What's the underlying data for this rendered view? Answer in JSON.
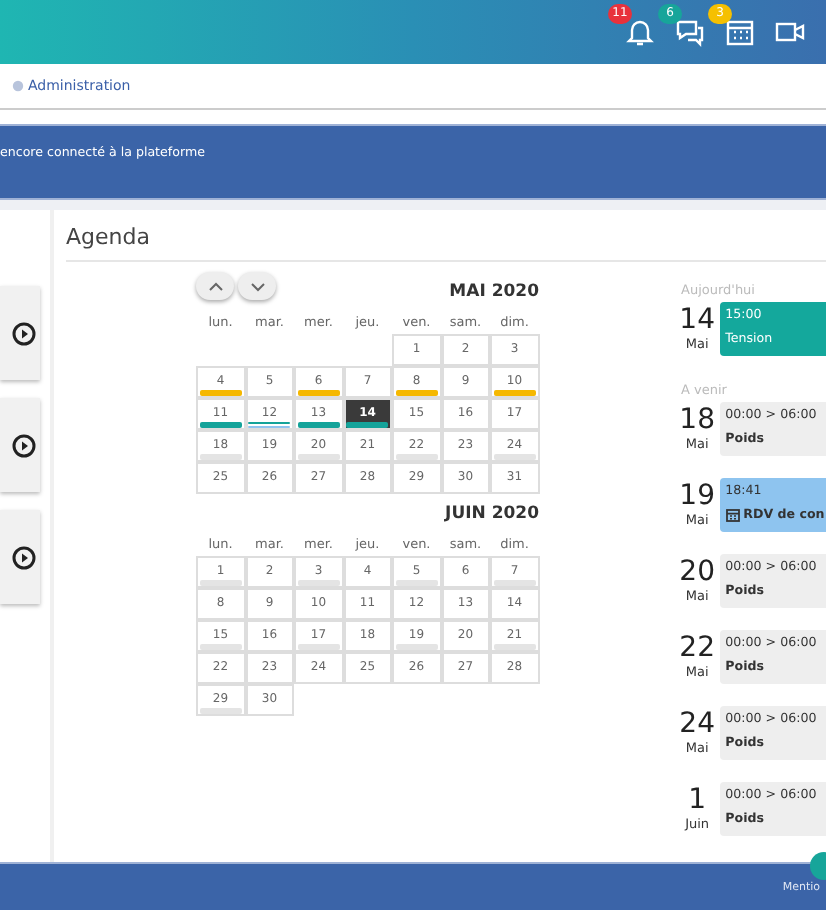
{
  "header": {
    "icons": [
      {
        "kind": "bell",
        "badge": "11",
        "color": "#e8323c"
      },
      {
        "kind": "chat",
        "badge": "6",
        "color": "#17a59a"
      },
      {
        "kind": "calendar",
        "badge": "3",
        "color": "#f5c000"
      },
      {
        "kind": "video"
      }
    ]
  },
  "breadcrumb": {
    "label": "Administration"
  },
  "banner": {
    "text": "encore connecté à la plateforme"
  },
  "sidebar": {
    "cards": [
      {
        "kind": "play"
      },
      {
        "kind": "play"
      },
      {
        "kind": "play"
      }
    ]
  },
  "agenda": {
    "title": "Agenda",
    "calendar": {
      "months": [
        {
          "title": "MAI 2020",
          "weekdays": [
            "lun.",
            "mar.",
            "mer.",
            "jeu.",
            "ven.",
            "sam.",
            "dim."
          ],
          "weeks": [
            {
              "kind": "partial_start",
              "days": [
                {
                  "label": "1",
                  "selected": false
                },
                {
                  "label": "2",
                  "selected": false
                },
                {
                  "label": "3",
                  "selected": false
                }
              ]
            },
            [
              {
                "label": "4",
                "selected": false,
                "marks": [
                  {
                    "color": "#f5b800"
                  }
                ]
              },
              {
                "label": "5",
                "selected": false
              },
              {
                "label": "6",
                "selected": false,
                "marks": [
                  {
                    "color": "#f5b800"
                  }
                ]
              },
              {
                "label": "7",
                "selected": false
              },
              {
                "label": "8",
                "selected": false,
                "marks": [
                  {
                    "color": "#f5b800"
                  }
                ]
              },
              {
                "label": "9",
                "selected": false
              },
              {
                "label": "10",
                "selected": false,
                "marks": [
                  {
                    "color": "#f5b800"
                  }
                ]
              }
            ],
            [
              {
                "label": "11",
                "selected": false,
                "marks": [
                  {
                    "color": "#14a39a"
                  }
                ]
              },
              {
                "label": "12",
                "selected": false,
                "marks": [
                  {
                    "color": "#14a39a"
                  },
                  {
                    "color": "#8fc4f0"
                  }
                ]
              },
              {
                "label": "13",
                "selected": false,
                "marks": [
                  {
                    "color": "#14a39a"
                  }
                ]
              },
              {
                "label": "14",
                "selected": true,
                "marks": [
                  {
                    "color": "#14a39a"
                  }
                ]
              },
              {
                "label": "15",
                "selected": false
              },
              {
                "label": "16",
                "selected": false
              },
              {
                "label": "17",
                "selected": false
              }
            ],
            [
              {
                "label": "18",
                "selected": false,
                "marks": [
                  {
                    "color": "#e4e4e4"
                  }
                ]
              },
              {
                "label": "19",
                "selected": false
              },
              {
                "label": "20",
                "selected": false,
                "marks": [
                  {
                    "color": "#e4e4e4"
                  }
                ]
              },
              {
                "label": "21",
                "selected": false
              },
              {
                "label": "22",
                "selected": false,
                "marks": [
                  {
                    "color": "#e4e4e4"
                  }
                ]
              },
              {
                "label": "23",
                "selected": false
              },
              {
                "label": "24",
                "selected": false,
                "marks": [
                  {
                    "color": "#e4e4e4"
                  }
                ]
              }
            ],
            [
              {
                "label": "25",
                "selected": false
              },
              {
                "label": "26",
                "selected": false
              },
              {
                "label": "27",
                "selected": false
              },
              {
                "label": "28",
                "selected": false
              },
              {
                "label": "29",
                "selected": false
              },
              {
                "label": "30",
                "selected": false
              },
              {
                "label": "31",
                "selected": false
              }
            ]
          ]
        },
        {
          "title": "JUIN 2020",
          "weekdays": [
            "lun.",
            "mar.",
            "mer.",
            "jeu.",
            "ven.",
            "sam.",
            "dim."
          ],
          "weeks": [
            [
              {
                "label": "1",
                "selected": false,
                "marks": [
                  {
                    "color": "#e4e4e4"
                  }
                ]
              },
              {
                "label": "2",
                "selected": false
              },
              {
                "label": "3",
                "selected": false,
                "marks": [
                  {
                    "color": "#e4e4e4"
                  }
                ]
              },
              {
                "label": "4",
                "selected": false
              },
              {
                "label": "5",
                "selected": false,
                "marks": [
                  {
                    "color": "#e4e4e4"
                  }
                ]
              },
              {
                "label": "6",
                "selected": false
              },
              {
                "label": "7",
                "selected": false,
                "marks": [
                  {
                    "color": "#e4e4e4"
                  }
                ]
              }
            ],
            [
              {
                "label": "8",
                "selected": false
              },
              {
                "label": "9",
                "selected": false
              },
              {
                "label": "10",
                "selected": false
              },
              {
                "label": "11",
                "selected": false
              },
              {
                "label": "12",
                "selected": false
              },
              {
                "label": "13",
                "selected": false
              },
              {
                "label": "14",
                "selected": false
              }
            ],
            [
              {
                "label": "15",
                "selected": false,
                "marks": [
                  {
                    "color": "#e4e4e4"
                  }
                ]
              },
              {
                "label": "16",
                "selected": false
              },
              {
                "label": "17",
                "selected": false,
                "marks": [
                  {
                    "color": "#e4e4e4"
                  }
                ]
              },
              {
                "label": "18",
                "selected": false
              },
              {
                "label": "19",
                "selected": false,
                "marks": [
                  {
                    "color": "#e4e4e4"
                  }
                ]
              },
              {
                "label": "20",
                "selected": false
              },
              {
                "label": "21",
                "selected": false,
                "marks": [
                  {
                    "color": "#e4e4e4"
                  }
                ]
              }
            ],
            [
              {
                "label": "22",
                "selected": false
              },
              {
                "label": "23",
                "selected": false
              },
              {
                "label": "24",
                "selected": false
              },
              {
                "label": "25",
                "selected": false
              },
              {
                "label": "26",
                "selected": false
              },
              {
                "label": "27",
                "selected": false
              },
              {
                "label": "28",
                "selected": false
              }
            ],
            [
              {
                "label": "29",
                "selected": false,
                "marks": [
                  {
                    "color": "#e4e4e4"
                  }
                ]
              },
              {
                "label": "30",
                "selected": false
              }
            ]
          ]
        }
      ]
    },
    "sections": [
      {
        "label": "Aujourd'hui",
        "items": [
          {
            "day": "14",
            "month": "Mai",
            "events": [
              {
                "kind": "measure",
                "time": "15:00",
                "title": "Tension",
                "color": "#14a89c"
              }
            ]
          }
        ]
      },
      {
        "label": "A venir",
        "items": [
          {
            "day": "18",
            "month": "Mai",
            "events": [
              {
                "kind": "measure",
                "time": "00:00 > 06:00",
                "title": "Poids",
                "color": "#eeeeee"
              }
            ]
          },
          {
            "day": "19",
            "month": "Mai",
            "events": [
              {
                "kind": "appointment",
                "time": "18:41",
                "title": "RDV de con",
                "color": "#8ec4ef"
              }
            ]
          },
          {
            "day": "20",
            "month": "Mai",
            "events": [
              {
                "kind": "measure",
                "time": "00:00 > 06:00",
                "title": "Poids",
                "color": "#eeeeee"
              }
            ]
          },
          {
            "day": "22",
            "month": "Mai",
            "events": [
              {
                "kind": "measure",
                "time": "00:00 > 06:00",
                "title": "Poids",
                "color": "#eeeeee"
              }
            ]
          },
          {
            "day": "24",
            "month": "Mai",
            "events": [
              {
                "kind": "measure",
                "time": "00:00 > 06:00",
                "title": "Poids",
                "color": "#eeeeee"
              }
            ]
          },
          {
            "day": "1",
            "month": "Juin",
            "events": [
              {
                "kind": "measure",
                "time": "00:00 > 06:00",
                "title": "Poids",
                "color": "#eeeeee"
              }
            ]
          }
        ]
      }
    ]
  },
  "footer": {
    "link": "Mentio"
  }
}
